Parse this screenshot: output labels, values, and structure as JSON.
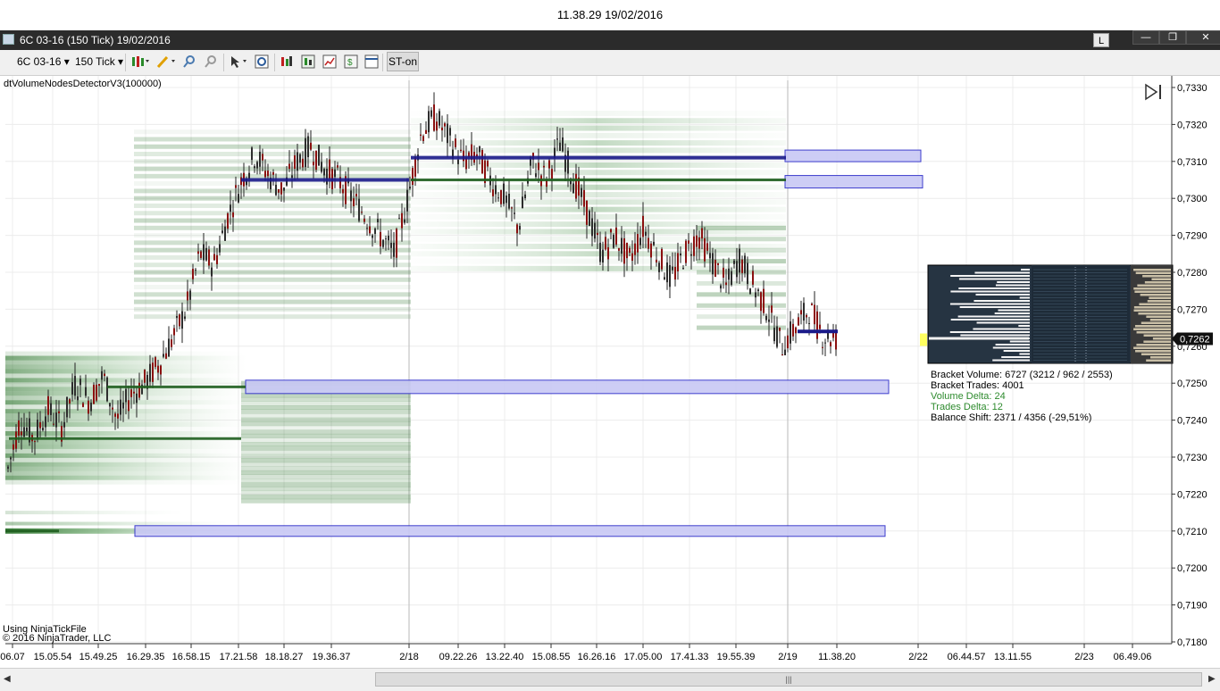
{
  "window": {
    "caption": "11.38.29 19/02/2016",
    "title": "6C 03-16 (150 Tick)  19/02/2016",
    "l_button": "L",
    "minimize_icon": "minimize-icon",
    "restore_icon": "restore-icon",
    "close_icon": "close-icon"
  },
  "toolbar": {
    "instrument": "6C 03-16",
    "interval": "150 Tick",
    "st_button": "ST-on",
    "icons": [
      "candlestick-style-icon",
      "drawing-pencil-icon",
      "zoom-in-icon",
      "zoom-out-icon",
      "cursor-icon",
      "magnify-icon",
      "bar-spacing-icon",
      "data-box-icon",
      "chart-properties-icon",
      "instrument-icon",
      "template-icon"
    ]
  },
  "chart": {
    "indicator_label": "dtVolumeNodesDetectorV3(100000)",
    "copyright_line1": "Using NinjaTickFile",
    "copyright_line2": "© 2016 NinjaTrader, LLC",
    "current_price_label": "0,7262",
    "price_axis": [
      "0,7330",
      "0,7320",
      "0,7310",
      "0,7300",
      "0,7290",
      "0,7280",
      "0,7270",
      "0,7260",
      "0,7250",
      "0,7240",
      "0,7230",
      "0,7220",
      "0,7210",
      "0,7200",
      "0,7190",
      "0,7180"
    ],
    "time_axis": [
      "06.07",
      "15.05.54",
      "15.49.25",
      "16.29.35",
      "16.58.15",
      "17.21.58",
      "18.18.27",
      "19.36.37",
      "2/18",
      "09.22.26",
      "13.22.40",
      "15.08.55",
      "16.26.16",
      "17.05.00",
      "17.41.33",
      "19.55.39",
      "2/19",
      "11.38.20",
      "2/22",
      "06.44.57",
      "13.11.55",
      "2/23",
      "06.49.06"
    ],
    "stats": {
      "bracket_volume": "Bracket Volume: 6727 (3212 / 962 / 2553)",
      "bracket_trades": "Bracket Trades: 4001",
      "volume_delta": "Volume Delta: 24",
      "trades_delta": "Trades Delta: 12",
      "balance_shift": "Balance Shift: 2371 / 4356 (-29,51%)"
    },
    "price_series": [
      0.7225,
      0.724,
      0.7235,
      0.7243,
      0.7238,
      0.725,
      0.7245,
      0.7252,
      0.724,
      0.7247,
      0.725,
      0.7255,
      0.7262,
      0.727,
      0.7285,
      0.7282,
      0.7295,
      0.7305,
      0.7312,
      0.7306,
      0.7302,
      0.731,
      0.7314,
      0.7308,
      0.7305,
      0.73,
      0.7295,
      0.729,
      0.7285,
      0.73,
      0.7318,
      0.7322,
      0.7316,
      0.731,
      0.7312,
      0.7305,
      0.73,
      0.7292,
      0.731,
      0.7305,
      0.7315,
      0.7305,
      0.7296,
      0.7285,
      0.729,
      0.7283,
      0.7292,
      0.7285,
      0.7278,
      0.7285,
      0.729,
      0.7283,
      0.7276,
      0.7284,
      0.7276,
      0.727,
      0.726,
      0.7265,
      0.727,
      0.7263,
      0.7262
    ],
    "volume_node_lines_prices": [
      0.7305,
      0.7311,
      0.7305,
      0.7249,
      0.7235,
      0.721
    ],
    "bracket_boxes_prices": [
      0.73115,
      0.73045,
      0.7249,
      0.721
    ]
  },
  "scrollbar": {
    "left_icon": "scroll-left-icon",
    "right_icon": "scroll-right-icon",
    "thumb_grip": "|||"
  },
  "colors": {
    "volume_node": "#1f6b1f",
    "node_line": "#1a1a8a",
    "bracket_box_fill": "#c8c8f5",
    "bracket_box_border": "#2a2ac8",
    "candle_down": "#8b1010",
    "candle_up": "#2d2d2d",
    "profile_bg": "#263442"
  }
}
